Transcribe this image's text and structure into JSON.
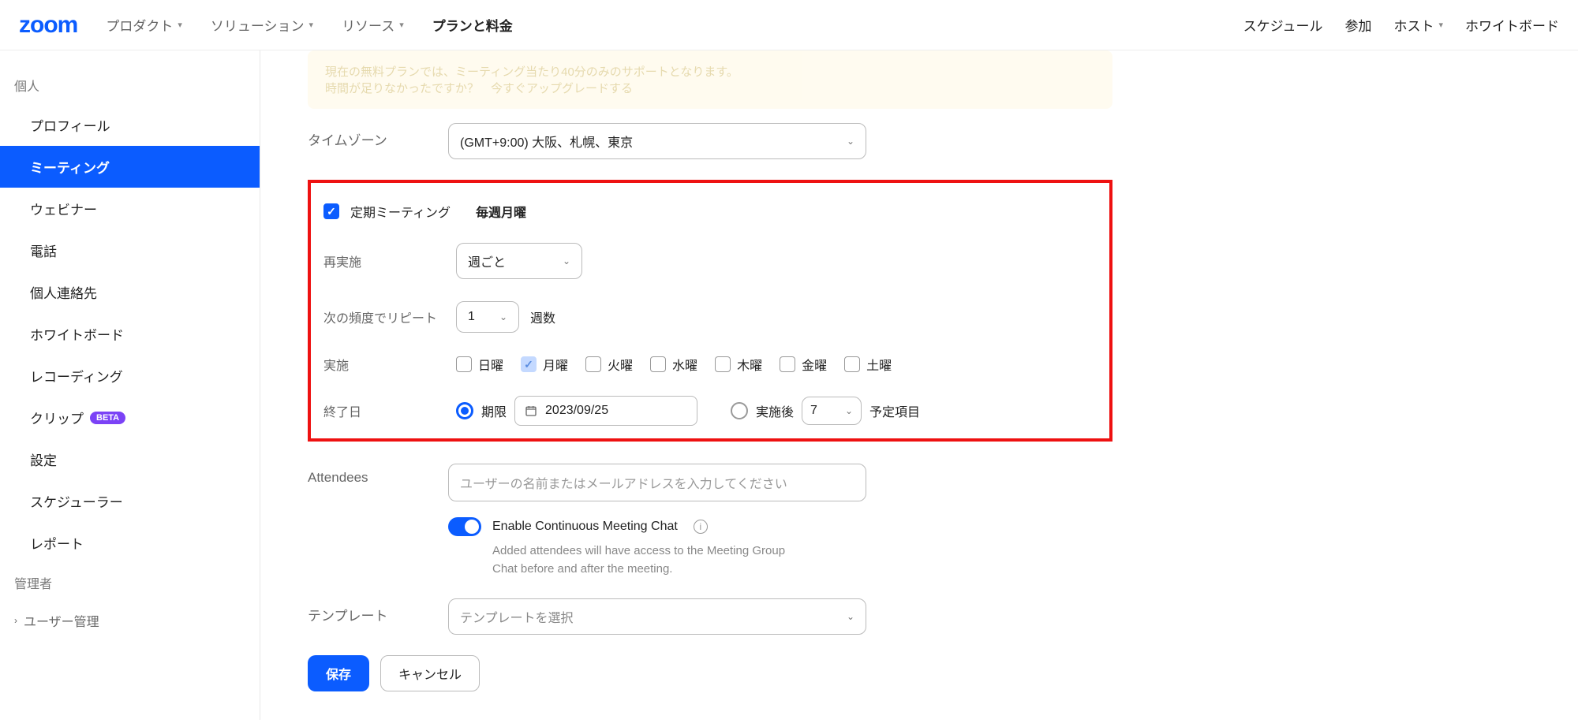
{
  "header": {
    "logo": "zoom",
    "nav_left": [
      "プロダクト",
      "ソリューション",
      "リソース"
    ],
    "nav_emph": "プランと料金",
    "nav_right": [
      "スケジュール",
      "参加",
      "ホスト",
      "ホワイトボード"
    ]
  },
  "banner": {
    "line1": "現在の無料プランでは、ミーティング当たり40分のみのサポートとなります。",
    "line2": "時間が足りなかったですか？　今すぐアップグレードする"
  },
  "sidebar": {
    "section_personal": "個人",
    "items": [
      "プロフィール",
      "ミーティング",
      "ウェビナー",
      "電話",
      "個人連絡先",
      "ホワイトボード",
      "レコーディング",
      "クリップ",
      "設定",
      "スケジューラー",
      "レポート"
    ],
    "beta": "BETA",
    "section_admin": "管理者",
    "admin_item": "ユーザー管理"
  },
  "form": {
    "timezone_label": "タイムゾーン",
    "timezone_value": "(GMT+9:00) 大阪、札幌、東京",
    "recurring_label": "定期ミーティング",
    "recurring_summary": "毎週月曜",
    "recurrence_label": "再実施",
    "recurrence_value": "週ごと",
    "repeat_label": "次の頻度でリピート",
    "repeat_value": "1",
    "repeat_unit": "週数",
    "occurs_label": "実施",
    "days": [
      "日曜",
      "月曜",
      "火曜",
      "水曜",
      "木曜",
      "金曜",
      "土曜"
    ],
    "end_label": "終了日",
    "end_by_label": "期限",
    "end_by_date": "2023/09/25",
    "end_after_label": "実施後",
    "end_after_count": "7",
    "end_after_unit": "予定項目",
    "attendees_label": "Attendees",
    "attendees_placeholder": "ユーザーの名前またはメールアドレスを入力してください",
    "chat_label": "Enable Continuous Meeting Chat",
    "chat_hint": "Added attendees will have access to the Meeting Group Chat before and after the meeting.",
    "template_label": "テンプレート",
    "template_placeholder": "テンプレートを選択",
    "save": "保存",
    "cancel": "キャンセル"
  }
}
